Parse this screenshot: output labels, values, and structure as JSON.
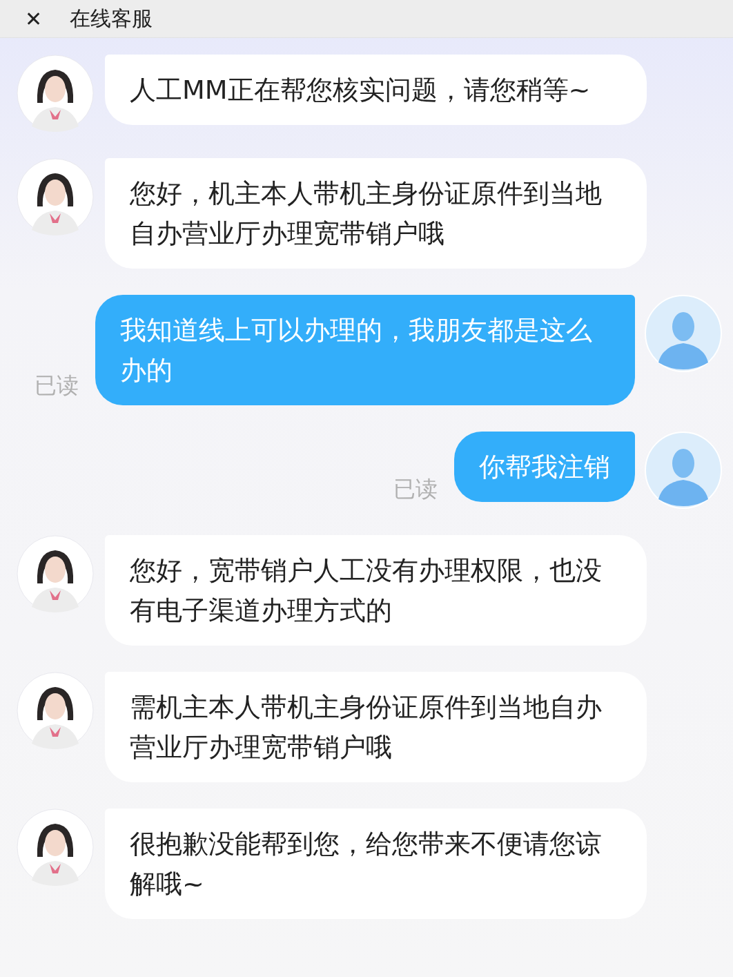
{
  "header": {
    "back_icon": "✕",
    "title": "在线客服"
  },
  "messages": [
    {
      "kind": "agent",
      "text": "人工MM正在帮您核实问题，请您稍等~"
    },
    {
      "kind": "agent",
      "text": "您好，机主本人带机主身份证原件到当地自办营业厅办理宽带销户哦"
    },
    {
      "kind": "user",
      "text": "我知道线上可以办理的，我朋友都是这么办的",
      "status": "已读"
    },
    {
      "kind": "user",
      "text": "你帮我注销",
      "status": "已读"
    },
    {
      "kind": "agent",
      "text": "您好，宽带销户人工没有办理权限，也没有电子渠道办理方式的"
    },
    {
      "kind": "agent",
      "text": "需机主本人带机主身份证原件到当地自办营业厅办理宽带销户哦"
    },
    {
      "kind": "agent",
      "text": "很抱歉没能帮到您，给您带来不便请您谅解哦~"
    }
  ]
}
